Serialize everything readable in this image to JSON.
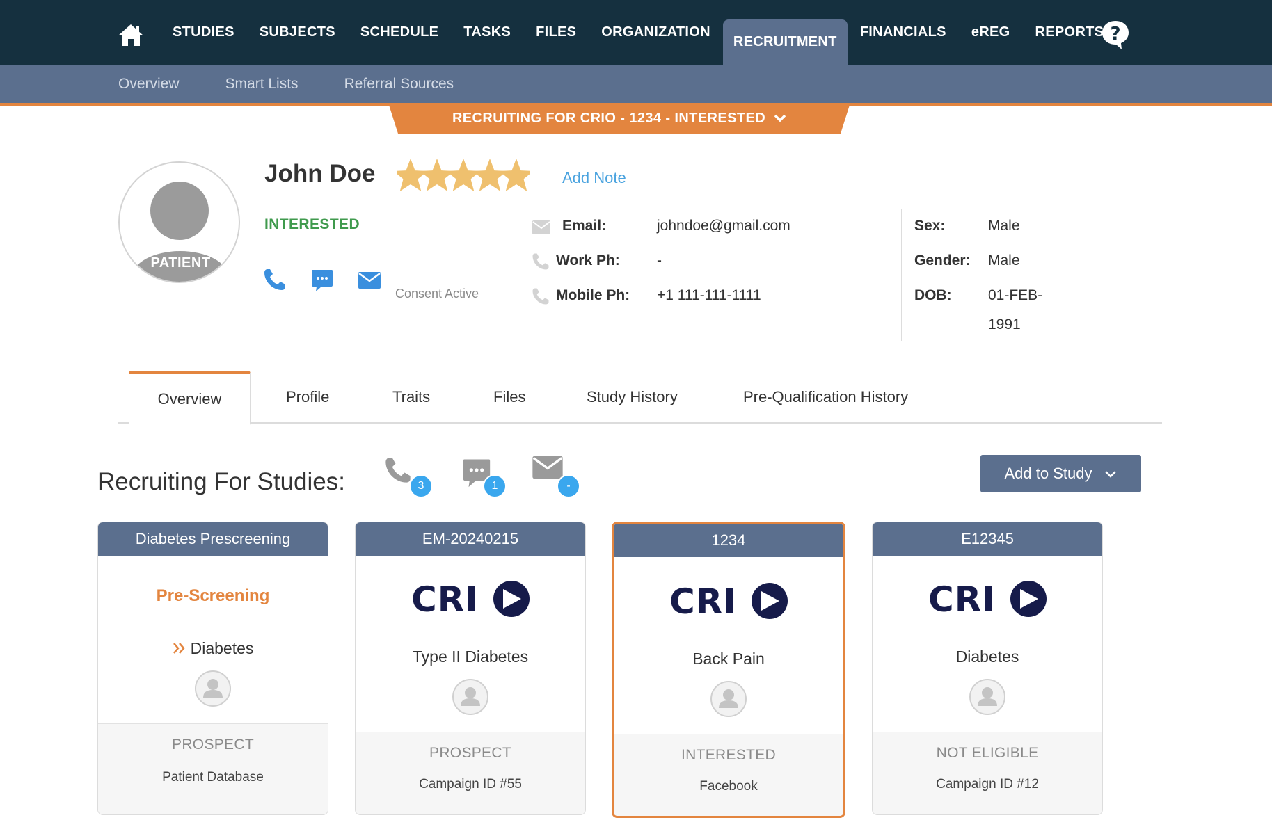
{
  "nav": {
    "items": [
      {
        "label": "STUDIES",
        "active": false
      },
      {
        "label": "SUBJECTS",
        "active": false
      },
      {
        "label": "SCHEDULE",
        "active": false
      },
      {
        "label": "TASKS",
        "active": false
      },
      {
        "label": "FILES",
        "active": false
      },
      {
        "label": "ORGANIZATION",
        "active": false
      },
      {
        "label": "RECRUITMENT",
        "active": true
      },
      {
        "label": "FINANCIALS",
        "active": false
      },
      {
        "label": "eREG",
        "active": false
      },
      {
        "label": "REPORTS",
        "active": false
      }
    ],
    "icons": {
      "home": "home-icon",
      "help": "help-bubble-icon"
    }
  },
  "subnav": {
    "items": [
      "Overview",
      "Smart Lists",
      "Referral Sources"
    ]
  },
  "banner": {
    "label": "RECRUITING FOR CRIO - 1234 - INTERESTED"
  },
  "patient": {
    "badge": "PATIENT",
    "name": "John Doe",
    "rating": 5,
    "add_note": "Add Note",
    "status": "INTERESTED",
    "consent": "Consent Active",
    "contact": {
      "email_label": "Email:",
      "email": "johndoe@gmail.com",
      "work_label": "Work Ph:",
      "work": "-",
      "mobile_label": "Mobile Ph:",
      "mobile": "+1 111-111-1111"
    },
    "demographics": {
      "sex_label": "Sex:",
      "sex": "Male",
      "gender_label": "Gender:",
      "gender": "Male",
      "dob_label": "DOB:",
      "dob_line1": "01-FEB-",
      "dob_line2": "1991"
    }
  },
  "tabs": [
    "Overview",
    "Profile",
    "Traits",
    "Files",
    "Study History",
    "Pre-Qualification History"
  ],
  "recruiting": {
    "title": "Recruiting For Studies:",
    "counts": {
      "calls": "3",
      "messages": "1",
      "emails": "-"
    },
    "add_study": "Add to Study"
  },
  "cards": [
    {
      "header": "Diabetes Prescreening",
      "subtitle": "Pre-Screening",
      "condition": "Diabetes",
      "status": "PROSPECT",
      "source": "Patient Database",
      "selected": false
    },
    {
      "header": "EM-20240215",
      "logo": "CRIO",
      "condition": "Type II Diabetes",
      "status": "PROSPECT",
      "source": "Campaign ID #55",
      "selected": false
    },
    {
      "header": "1234",
      "logo": "CRIO",
      "condition": "Back Pain",
      "status": "INTERESTED",
      "source": "Facebook",
      "selected": true
    },
    {
      "header": "E12345",
      "logo": "CRIO",
      "condition": "Diabetes",
      "status": "NOT ELIGIBLE",
      "source": "Campaign ID #12",
      "selected": false
    }
  ],
  "colors": {
    "nav_bg": "#15303f",
    "subnav_bg": "#5b6f8e",
    "accent_orange": "#e3853f",
    "interested_green": "#3f9a4d",
    "link_blue": "#4aa3df",
    "badge_blue": "#3aa7ee",
    "logo_navy": "#161b4a"
  }
}
